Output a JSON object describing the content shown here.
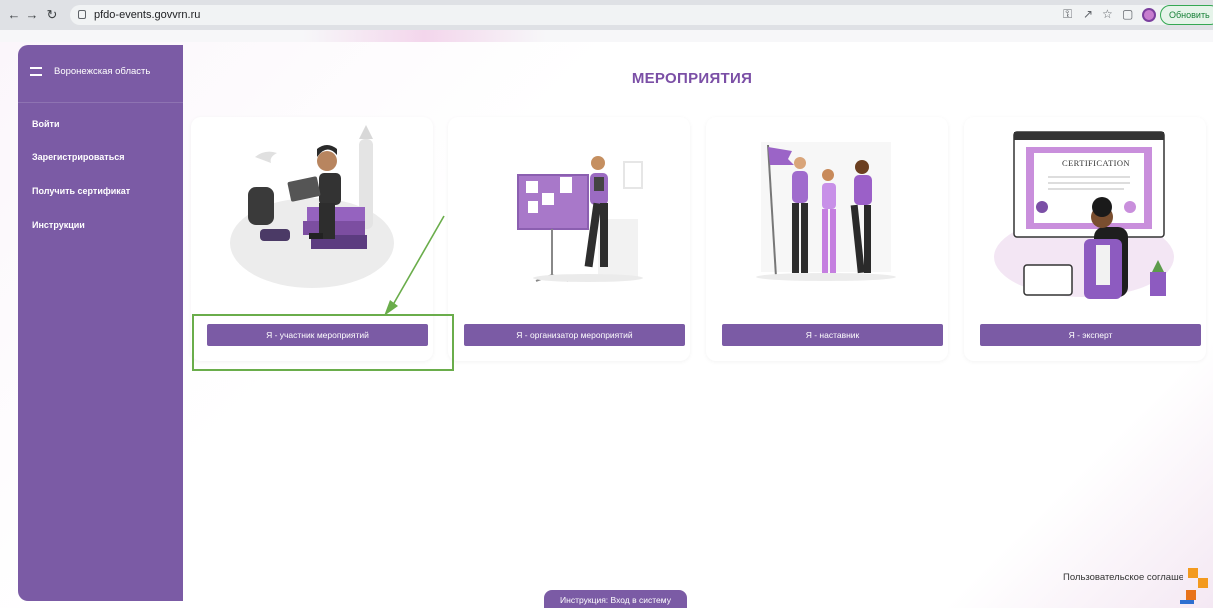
{
  "browser": {
    "url": "pfdo-events.govvrn.ru",
    "update_label": "Обновить"
  },
  "sidebar": {
    "region": "Воронежская область",
    "items": [
      {
        "label": "Войти"
      },
      {
        "label": "Зарегистрироваться"
      },
      {
        "label": "Получить сертификат"
      },
      {
        "label": "Инструкции"
      }
    ]
  },
  "main": {
    "title": "МЕРОПРИЯТИЯ",
    "cards": [
      {
        "button": "Я - участник мероприятий",
        "illustration": "student-with-laptop"
      },
      {
        "button": "Я - организатор мероприятий",
        "illustration": "presenter-at-board"
      },
      {
        "button": "Я - наставник",
        "illustration": "group-with-flag"
      },
      {
        "button": "Я - эксперт",
        "illustration": "certification"
      }
    ],
    "certificate_text": "CERTIFICATION"
  },
  "footer": {
    "agreement": "Пользовательское соглашение",
    "instruction_tab": "Инструкция: Вход в систему"
  },
  "colors": {
    "accent": "#7b5ba5",
    "title": "#7b4fa6",
    "highlight": "#6aad4b"
  }
}
